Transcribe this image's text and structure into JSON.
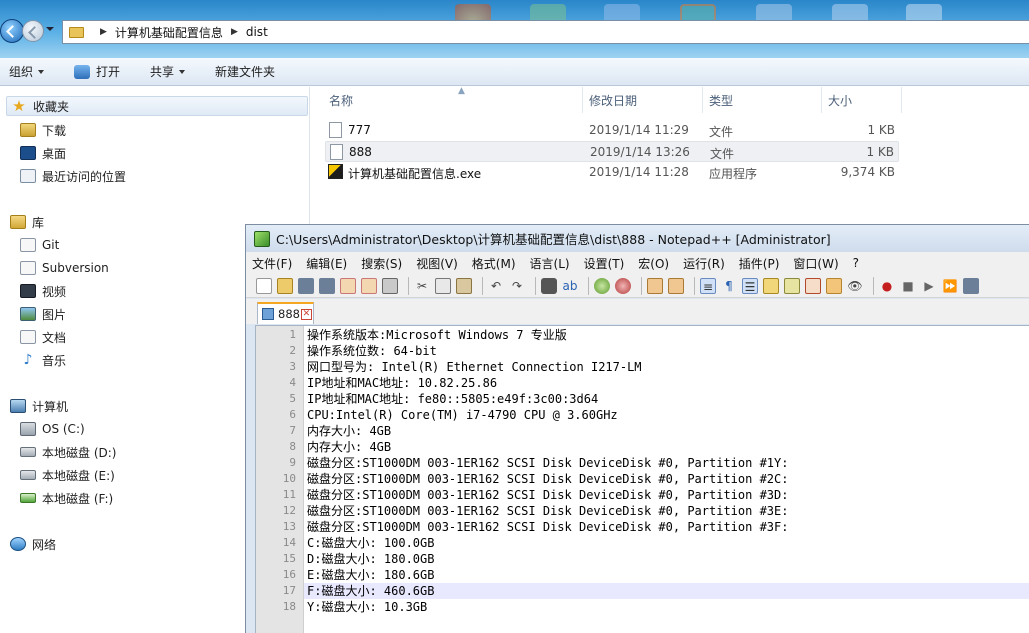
{
  "explorer": {
    "breadcrumbs": [
      "计算机基础配置信息",
      "dist"
    ],
    "toolbar": {
      "organize": "组织",
      "open": "打开",
      "share": "共享",
      "new_folder": "新建文件夹"
    },
    "nav": {
      "favorites": "收藏夹",
      "downloads": "下载",
      "desktop": "桌面",
      "recent": "最近访问的位置",
      "libraries": "库",
      "git": "Git",
      "subversion": "Subversion",
      "videos": "视频",
      "pictures": "图片",
      "documents": "文档",
      "music": "音乐",
      "computer": "计算机",
      "drive_c": "OS (C:)",
      "drive_d": "本地磁盘 (D:)",
      "drive_e": "本地磁盘 (E:)",
      "drive_f": "本地磁盘 (F:)",
      "network": "网络"
    },
    "columns": {
      "name": "名称",
      "date": "修改日期",
      "type": "类型",
      "size": "大小"
    },
    "files": [
      {
        "name": "777",
        "date": "2019/1/14 11:29",
        "type": "文件",
        "size": "1 KB"
      },
      {
        "name": "888",
        "date": "2019/1/14 13:26",
        "type": "文件",
        "size": "1 KB"
      },
      {
        "name": "计算机基础配置信息.exe",
        "date": "2019/1/14 11:28",
        "type": "应用程序",
        "size": "9,374 KB"
      }
    ]
  },
  "notepad": {
    "title": "C:\\Users\\Administrator\\Desktop\\计算机基础配置信息\\dist\\888 - Notepad++ [Administrator]",
    "menu": [
      "文件(F)",
      "编辑(E)",
      "搜索(S)",
      "视图(V)",
      "格式(M)",
      "语言(L)",
      "设置(T)",
      "宏(O)",
      "运行(R)",
      "插件(P)",
      "窗口(W)",
      "?"
    ],
    "tab_label": "888",
    "current_line": 17,
    "lines": [
      "操作系统版本:Microsoft Windows 7 专业版",
      "操作系统位数: 64-bit",
      "网口型号为: Intel(R) Ethernet Connection I217-LM",
      "IP地址和MAC地址: 10.82.25.86",
      "IP地址和MAC地址: fe80::5805:e49f:3c00:3d64",
      "CPU:Intel(R) Core(TM) i7-4790 CPU @ 3.60GHz",
      "内存大小: 4GB",
      "内存大小: 4GB",
      "磁盘分区:ST1000DM 003-1ER162 SCSI Disk DeviceDisk #0, Partition #1Y:",
      "磁盘分区:ST1000DM 003-1ER162 SCSI Disk DeviceDisk #0, Partition #2C:",
      "磁盘分区:ST1000DM 003-1ER162 SCSI Disk DeviceDisk #0, Partition #3D:",
      "磁盘分区:ST1000DM 003-1ER162 SCSI Disk DeviceDisk #0, Partition #3E:",
      "磁盘分区:ST1000DM 003-1ER162 SCSI Disk DeviceDisk #0, Partition #3F:",
      "C:磁盘大小: 100.0GB",
      "D:磁盘大小: 180.0GB",
      "E:磁盘大小: 180.6GB",
      "F:磁盘大小: 460.6GB",
      "Y:磁盘大小: 10.3GB"
    ],
    "line_numbers": [
      "1",
      "2",
      "3",
      "4",
      "5",
      "6",
      "7",
      "8",
      "9",
      "10",
      "11",
      "12",
      "13",
      "14",
      "15",
      "16",
      "17",
      "18"
    ]
  }
}
